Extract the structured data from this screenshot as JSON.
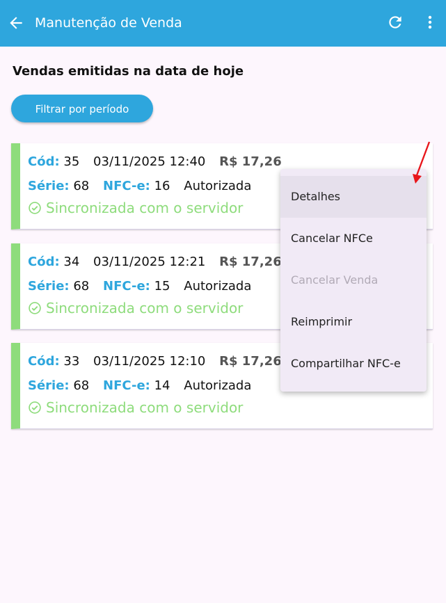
{
  "appbar": {
    "title": "Manutenção de Venda",
    "icons": [
      "back-arrow-icon",
      "refresh-icon",
      "more-vert-icon"
    ]
  },
  "main": {
    "heading": "Vendas emitidas na data de hoje",
    "filter_label": "Filtrar por período"
  },
  "labels": {
    "cod": "Cód:",
    "serie": "Série:",
    "nfce": "NFC-e:"
  },
  "sales": [
    {
      "cod": "35",
      "datetime": "03/11/2025 12:40",
      "price": "R$ 17,26",
      "serie": "68",
      "nfce": "16",
      "status": "Autorizada",
      "sync": "Sincronizada com o servidor"
    },
    {
      "cod": "34",
      "datetime": "03/11/2025 12:21",
      "price": "R$ 17,26",
      "serie": "68",
      "nfce": "15",
      "status": "Autorizada",
      "sync": "Sincronizada com o servidor"
    },
    {
      "cod": "33",
      "datetime": "03/11/2025 12:10",
      "price": "R$ 17,26",
      "serie": "68",
      "nfce": "14",
      "status": "Autorizada",
      "sync": "Sincronizada com o servidor"
    }
  ],
  "menu": {
    "items": [
      {
        "label": "Detalhes",
        "enabled": true
      },
      {
        "label": "Cancelar NFCe",
        "enabled": true
      },
      {
        "label": "Cancelar Venda",
        "enabled": false
      },
      {
        "label": "Reimprimir",
        "enabled": true
      },
      {
        "label": "Compartilhar NFC-e",
        "enabled": true
      }
    ]
  },
  "colors": {
    "primary": "#2ea6dd",
    "success": "#8edc7c",
    "background": "#fdf6fd",
    "annotation": "#e8161b"
  }
}
